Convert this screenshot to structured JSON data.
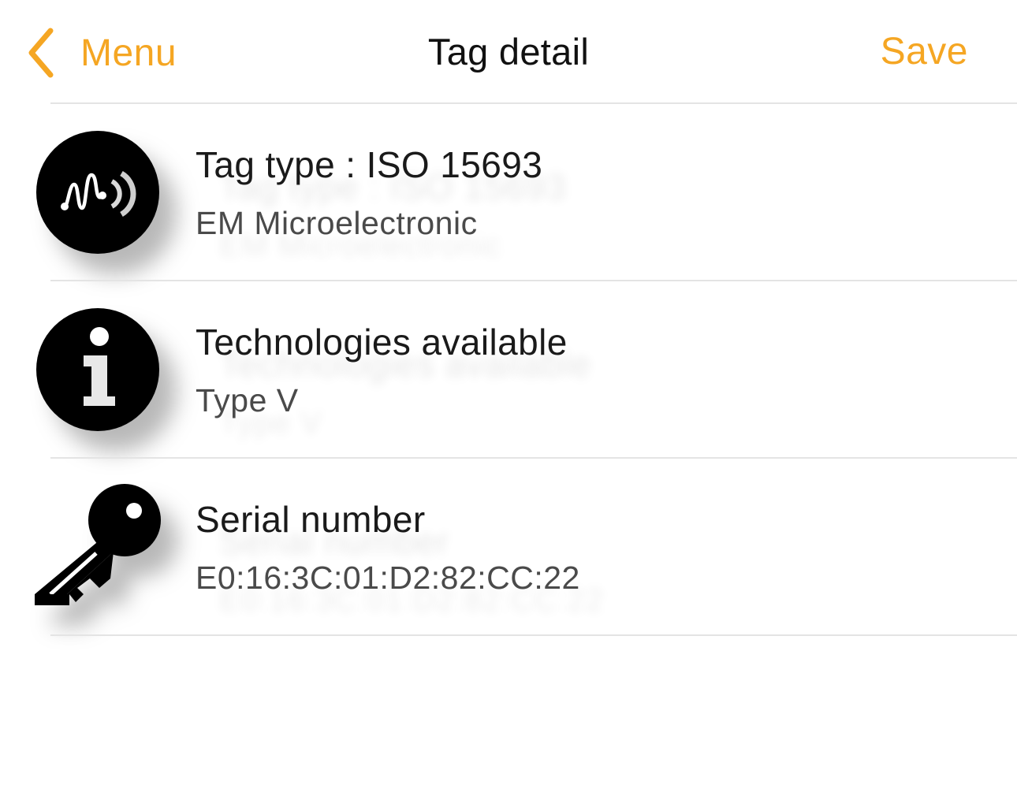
{
  "nav": {
    "back_label": "Menu",
    "title": "Tag detail",
    "save_label": "Save"
  },
  "colors": {
    "accent": "#f5a623",
    "text": "#111111",
    "subtext": "#4a4a4a",
    "divider": "#e4e4e4"
  },
  "rows": [
    {
      "icon": "nfc-signal-icon",
      "title": "Tag type : ISO 15693",
      "subtitle": "EM Microelectronic"
    },
    {
      "icon": "info-icon",
      "title": "Technologies available",
      "subtitle": "Type V"
    },
    {
      "icon": "key-icon",
      "title": "Serial number",
      "subtitle": "E0:16:3C:01:D2:82:CC:22"
    }
  ]
}
